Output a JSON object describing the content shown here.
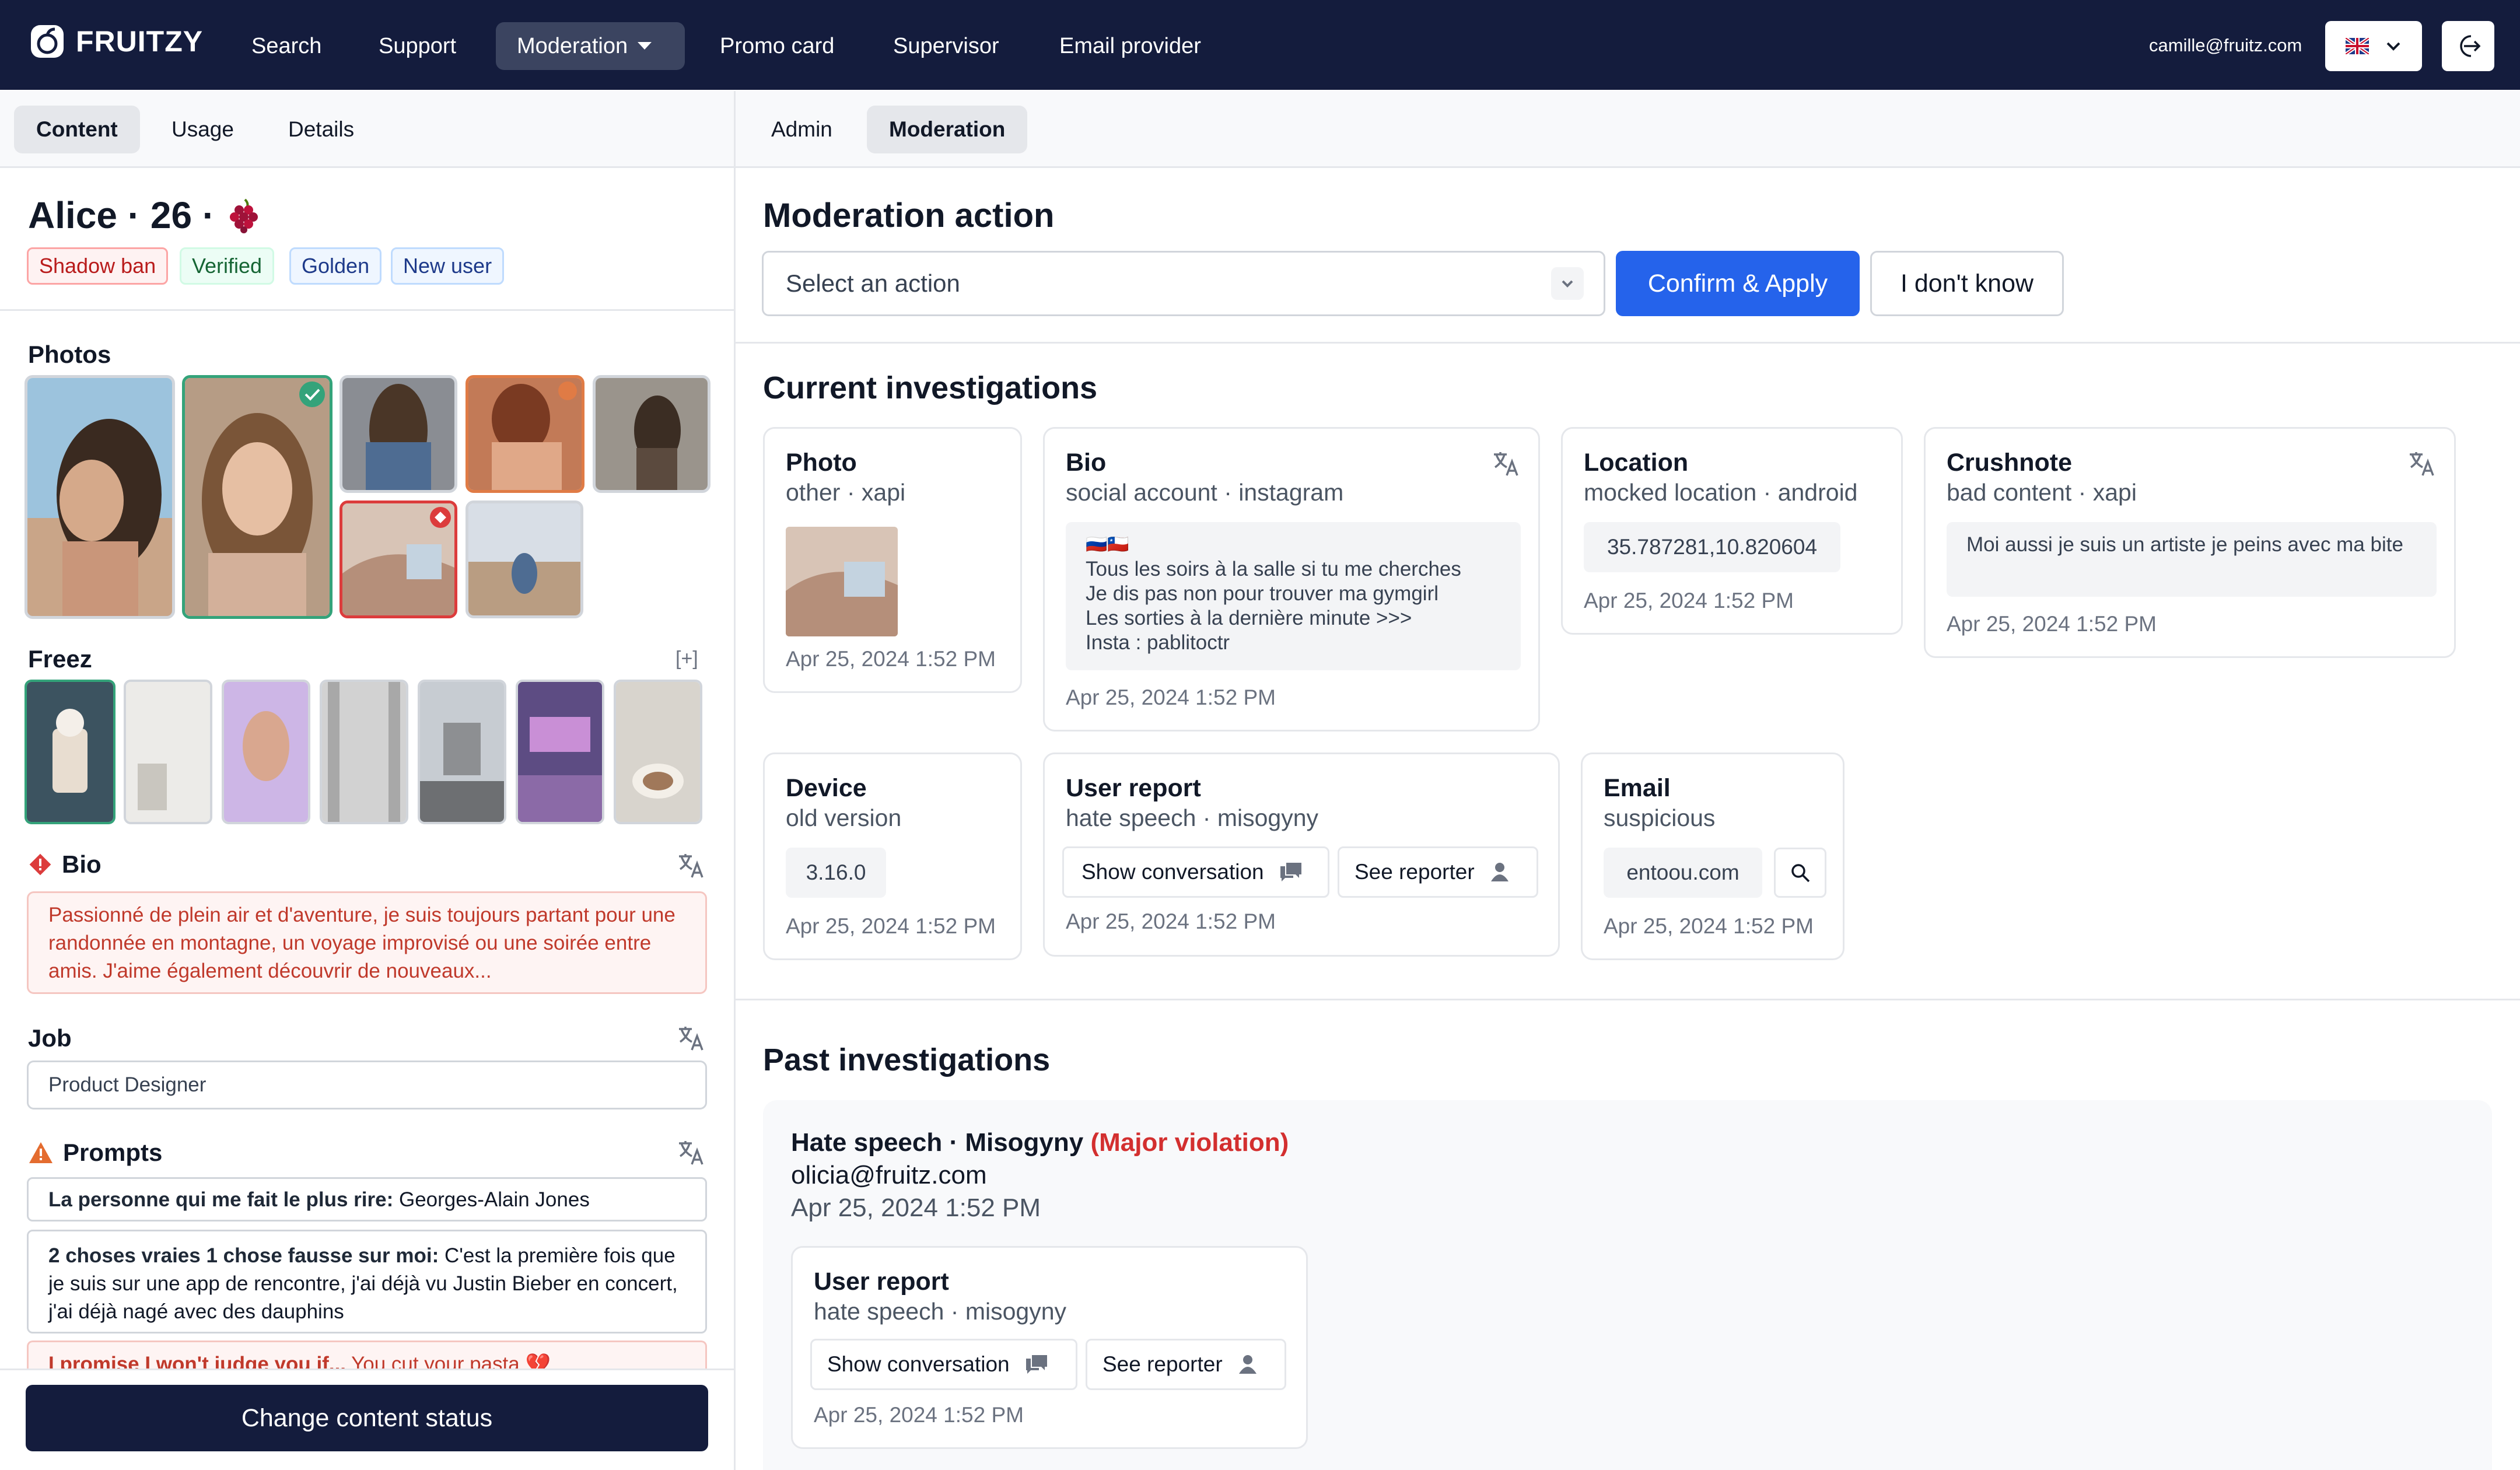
{
  "header": {
    "brand": "FRUITZY",
    "nav": [
      "Search",
      "Support",
      "Moderation",
      "Promo card",
      "Supervisor",
      "Email provider"
    ],
    "user_email": "camille@fruitz.com",
    "language_flag": "uk-flag-icon"
  },
  "left_tabs": [
    "Content",
    "Usage",
    "Details"
  ],
  "right_tabs": [
    "Admin",
    "Moderation"
  ],
  "profile": {
    "name": "Alice · 26 ·",
    "fruit_icon": "grapes-icon",
    "badges": [
      "Shadow ban",
      "Verified",
      "Golden",
      "New user"
    ]
  },
  "photos": {
    "title": "Photos"
  },
  "freez": {
    "title": "Freez",
    "expand": "[+]"
  },
  "bio": {
    "title": "Bio",
    "text": "Passionné de plein air et d'aventure, je suis toujours partant pour une randonnée en montagne, un voyage improvisé ou une soirée entre amis. J'aime également découvrir de nouveaux..."
  },
  "job": {
    "title": "Job",
    "value": "Product Designer"
  },
  "prompts": {
    "title": "Prompts",
    "items": [
      {
        "q": "La personne qui me fait le plus rire:",
        "a": " Georges-Alain Jones"
      },
      {
        "q": "2 choses vraies 1 chose fausse sur moi:",
        "a": " C'est la première fois que je suis sur une app de rencontre, j'ai déjà vu Justin Bieber en concert, j'ai déjà nagé avec des dauphins"
      },
      {
        "q": "I promise I won't judge you if...",
        "a": " You cut your pasta 💔"
      }
    ]
  },
  "change_status_button": "Change content status",
  "moderation": {
    "title": "Moderation action",
    "select_placeholder": "Select an action",
    "confirm": "Confirm & Apply",
    "dont_know": "I don't know"
  },
  "current": {
    "title": "Current investigations",
    "photo": {
      "title": "Photo",
      "sub": "other · xapi",
      "date": "Apr 25, 2024 1:52 PM"
    },
    "bio": {
      "title": "Bio",
      "sub": "social account · instagram",
      "flag": "🇷🇺🇨🇱",
      "text": [
        "Tous les soirs à la salle si tu me cherches",
        "Je dis pas non pour trouver ma gymgirl",
        "Les sorties à la dernière minute >>>",
        "Insta : pablitoctr"
      ],
      "date": "Apr 25, 2024 1:52 PM"
    },
    "location": {
      "title": "Location",
      "sub": "mocked location · android",
      "coords": "35.787281,10.820604",
      "date": "Apr 25, 2024 1:52 PM"
    },
    "crushnote": {
      "title": "Crushnote",
      "sub": "bad content · xapi",
      "text": "Moi aussi je suis un artiste je peins avec ma bite",
      "date": "Apr 25, 2024 1:52 PM"
    },
    "device": {
      "title": "Device",
      "sub": "old version",
      "version": "3.16.0",
      "date": "Apr 25, 2024 1:52 PM"
    },
    "user_report": {
      "title": "User report",
      "sub": "hate speech · misogyny",
      "show_conv": "Show conversation",
      "see_reporter": "See reporter",
      "date": "Apr 25, 2024 1:52 PM"
    },
    "email": {
      "title": "Email",
      "sub": "suspicious",
      "domain": "entoou.com",
      "date": "Apr 25, 2024 1:52 PM"
    }
  },
  "past": {
    "title": "Past investigations",
    "item": {
      "title": "Hate speech · Misogyny",
      "severity": "(Major violation)",
      "moderator": "olicia@fruitz.com",
      "date": "Apr 25, 2024 1:52 PM",
      "report": {
        "title": "User report",
        "sub": "hate speech · misogyny",
        "show_conv": "Show conversation",
        "see_reporter": "See reporter",
        "date": "Apr 25, 2024 1:52 PM"
      }
    }
  },
  "colors": {
    "navy": "#141c3d",
    "primary": "#2563eb",
    "danger": "#d32f2f",
    "verified": "#15803d",
    "golden": "#1e3a8a"
  }
}
